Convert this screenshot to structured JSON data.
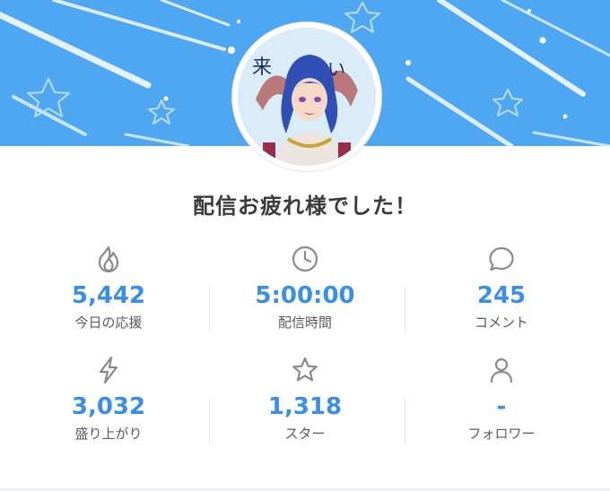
{
  "header": {
    "title": "配信お疲れ様でした！",
    "avatar_text": [
      "来",
      "い"
    ],
    "banner_color": "#4ea7f0"
  },
  "stats": [
    {
      "icon": "flame-icon",
      "value": "5,442",
      "label": "今日の応援"
    },
    {
      "icon": "clock-icon",
      "value": "5:00:00",
      "label": "配信時間"
    },
    {
      "icon": "comment-icon",
      "value": "245",
      "label": "コメント"
    },
    {
      "icon": "lightning-icon",
      "value": "3,032",
      "label": "盛り上がり"
    },
    {
      "icon": "star-icon",
      "value": "1,318",
      "label": "スター"
    },
    {
      "icon": "user-icon",
      "value": "-",
      "label": "フォロワー"
    }
  ],
  "colors": {
    "accent": "#3a8ee6",
    "label": "#5a5a5a",
    "icon": "#8a8a8a"
  }
}
